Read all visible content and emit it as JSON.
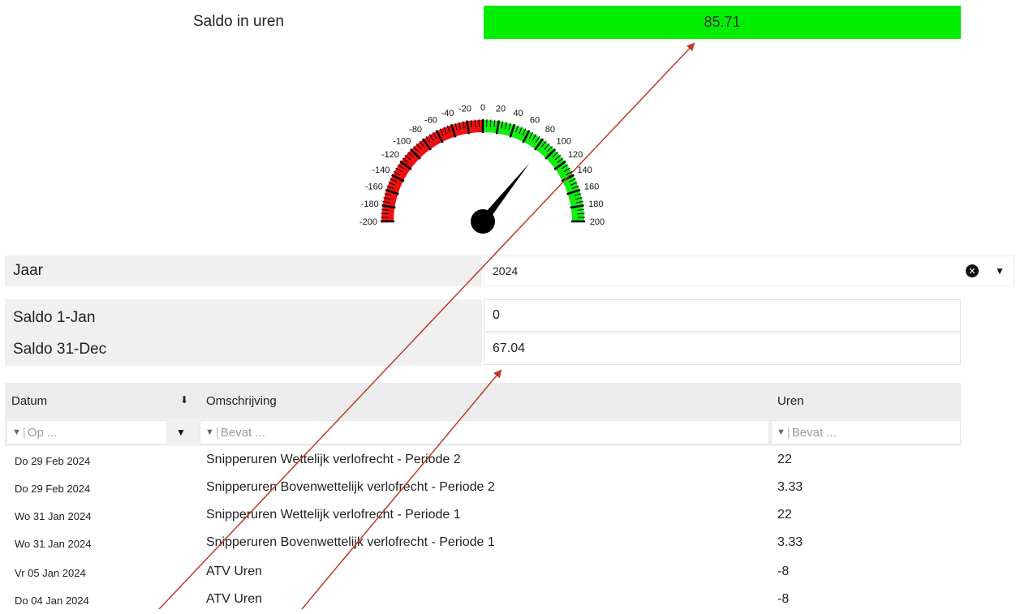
{
  "saldo": {
    "label": "Saldo in uren",
    "value": "85.71",
    "bar_color": "#00ee00"
  },
  "gauge": {
    "ticks": [
      "-200",
      "-180",
      "-160",
      "-140",
      "-120",
      "-100",
      "-80",
      "-60",
      "-40",
      "-20",
      "0",
      "20",
      "40",
      "60",
      "80",
      "100",
      "120",
      "140",
      "160",
      "180",
      "200"
    ],
    "min": -200,
    "max": 200,
    "value": 85.71,
    "negative_color": "#ee1111",
    "positive_color": "#11ee11"
  },
  "filters": {
    "jaar_label": "Jaar",
    "jaar_value": "2024",
    "saldo_start_label": "Saldo 1-Jan",
    "saldo_start_value": "0",
    "saldo_end_label": "Saldo 31-Dec",
    "saldo_end_value": "67.04"
  },
  "table": {
    "columns": {
      "datum": "Datum",
      "omschrijving": "Omschrijving",
      "uren": "Uren"
    },
    "filter_placeholders": {
      "datum": "Op ...",
      "omschrijving": "Bevat ...",
      "uren": "Bevat ..."
    },
    "rows": [
      {
        "datum": "Do 29 Feb 2024",
        "omschrijving": "Snipperuren Wettelijk verlofrecht - Periode 2",
        "uren": "22"
      },
      {
        "datum": "Do 29 Feb 2024",
        "omschrijving": "Snipperuren Bovenwettelijk verlofrecht - Periode 2",
        "uren": "3.33"
      },
      {
        "datum": "Wo 31 Jan 2024",
        "omschrijving": "Snipperuren Wettelijk verlofrecht - Periode 1",
        "uren": "22"
      },
      {
        "datum": "Wo 31 Jan 2024",
        "omschrijving": "Snipperuren Bovenwettelijk verlofrecht - Periode 1",
        "uren": "3.33"
      },
      {
        "datum": "Vr 05 Jan 2024",
        "omschrijving": "ATV Uren",
        "uren": "-8"
      },
      {
        "datum": "Do 04 Jan 2024",
        "omschrijving": "ATV Uren",
        "uren": "-8"
      }
    ]
  },
  "annotation_color": "#c0392b"
}
